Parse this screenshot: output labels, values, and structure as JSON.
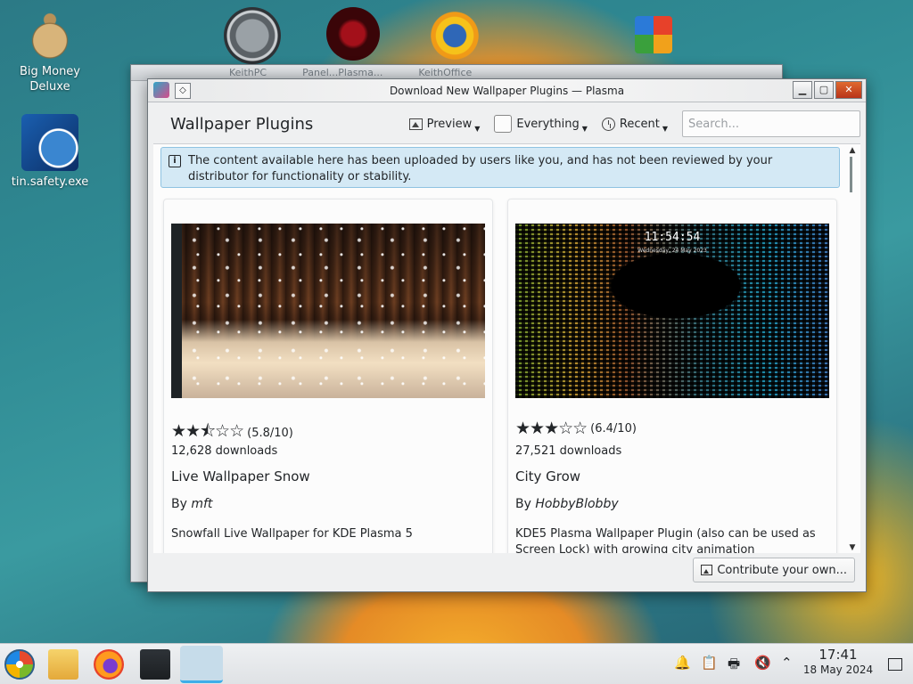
{
  "desktop": {
    "icons": [
      {
        "label_line1": "Big Money",
        "label_line2": "Deluxe",
        "icon": "money-bag-icon"
      },
      {
        "label_line1": "tin.safety.exe",
        "label_line2": "",
        "icon": "gear-app-icon"
      }
    ],
    "top_icons": [
      "speedometer-icon",
      "red-circle-icon",
      "sun-globe-icon",
      "office-icon"
    ]
  },
  "background_window": {
    "titles": [
      "KeithPC",
      "Panel...Plasma...",
      "KeithOffice"
    ]
  },
  "window": {
    "title": "Download New Wallpaper Plugins — Plasma",
    "pin_glyph": "◇",
    "controls": {
      "minimize": "▁",
      "maximize": "▢",
      "close": "✕"
    }
  },
  "header": {
    "title": "Wallpaper Plugins",
    "preview_label": "Preview",
    "filter_label": "Everything",
    "sort_label": "Recent",
    "search_placeholder": "Search..."
  },
  "notice": {
    "text": "The content available here has been uploaded by users like you, and has not been reviewed by your distributor for functionality or stability."
  },
  "items": [
    {
      "stars": "★★⯪☆☆",
      "rating": "(5.8/10)",
      "downloads": "12,628 downloads",
      "name": "Live Wallpaper Snow",
      "by": "By",
      "author": "mft",
      "description": "Snowfall Live Wallpaper for KDE Plasma 5"
    },
    {
      "stars": "★★★☆☆",
      "rating": "(6.4/10)",
      "downloads": "27,521 downloads",
      "name": "City Grow",
      "by": "By",
      "author": "HobbyBlobby",
      "description": "KDE5 Plasma Wallpaper Plugin (also can be used as Screen Lock) with growing city animation",
      "preview_clock": "11:54:54",
      "preview_date": "Wednesday, 24 May 2023"
    }
  ],
  "footer": {
    "contribute_label": "Contribute your own..."
  },
  "taskbar": {
    "time": "17:41",
    "date": "18 May 2024",
    "apps": [
      "start-menu-icon",
      "file-manager-icon",
      "firefox-icon",
      "settings-icon",
      "discover-icon"
    ]
  },
  "colors": {
    "accent": "#3daee9",
    "notice_bg": "#d4e9f5",
    "window_bg": "#eff0f1"
  }
}
